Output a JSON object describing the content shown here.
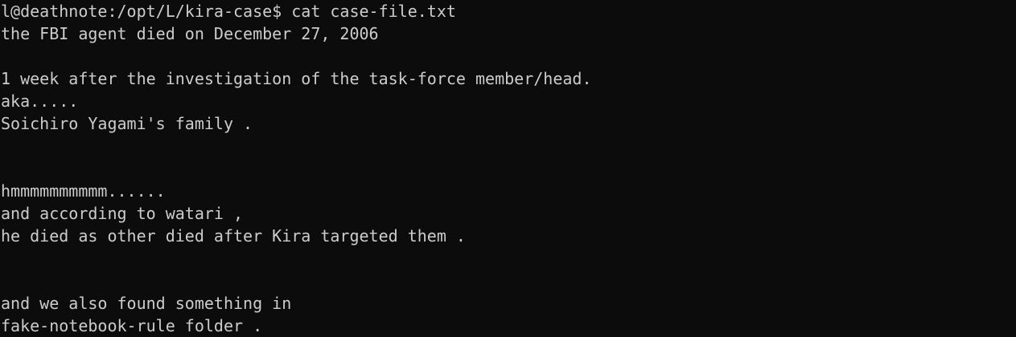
{
  "terminal": {
    "lines": [
      "l@deathnote:/opt/L/kira-case$ cat case-file.txt",
      "the FBI agent died on December 27, 2006",
      "",
      "1 week after the investigation of the task-force member/head.",
      "aka.....",
      "Soichiro Yagami's family .",
      "",
      "",
      "hmmmmmmmmmm......",
      "and according to watari ,",
      "he died as other died after Kira targeted them .",
      "",
      "",
      "and we also found something in",
      "fake-notebook-rule folder ."
    ]
  },
  "colors": {
    "background": "#0c0c0c",
    "foreground": "#cccccc"
  }
}
